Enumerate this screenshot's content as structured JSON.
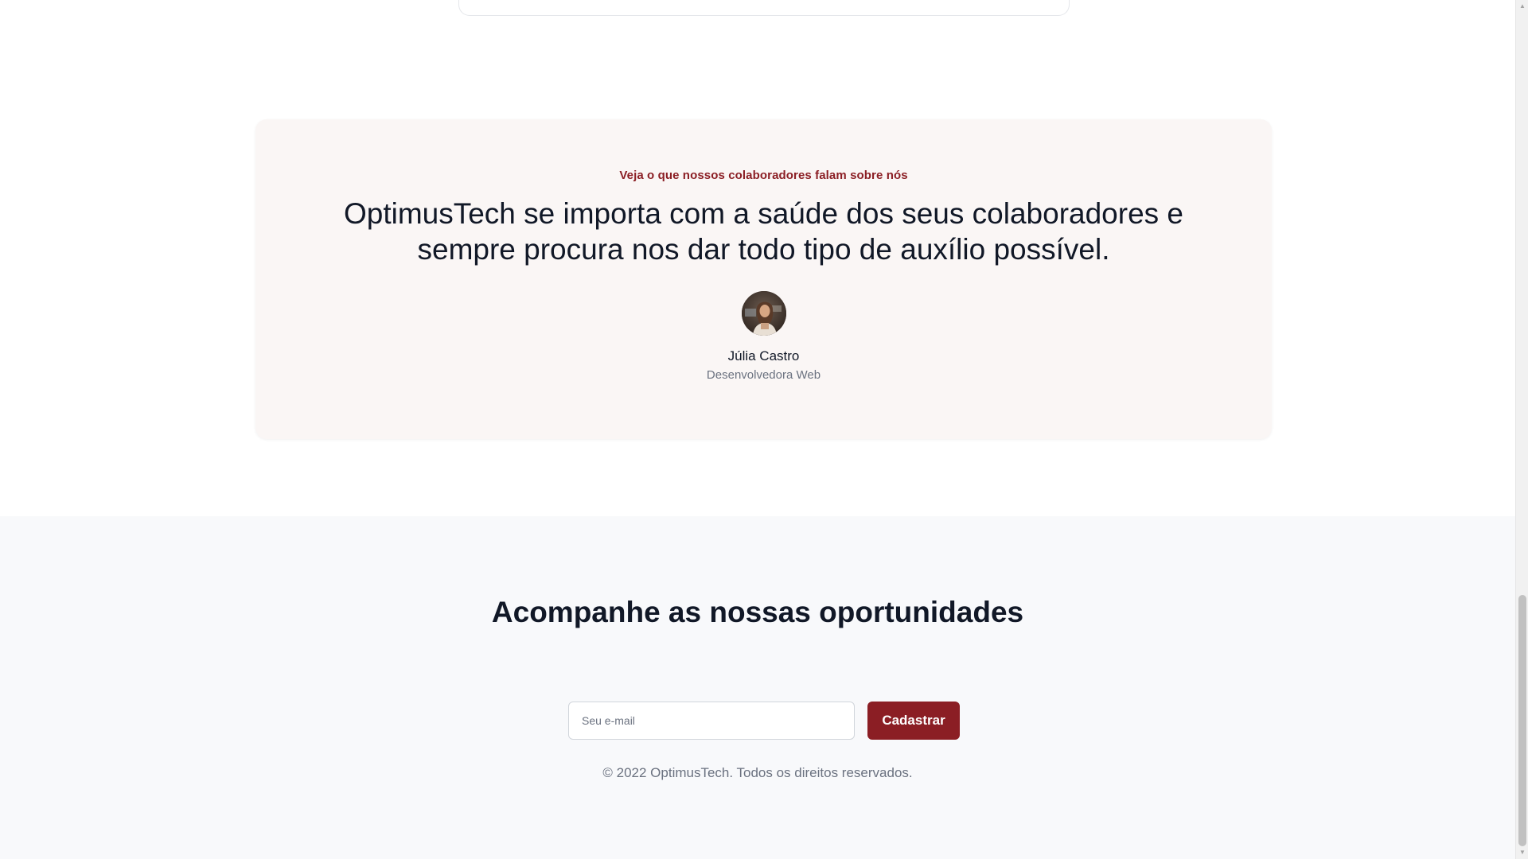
{
  "testimonial": {
    "eyebrow": "Veja o que nossos colaboradores falam sobre nós",
    "quote": "OptimusTech se importa com a saúde dos seus colaboradores e sempre procura nos dar todo tipo de auxílio possível.",
    "author_name": "Júlia Castro",
    "author_role": "Desenvolvedora Web",
    "avatar_icon": "person-photo"
  },
  "newsletter": {
    "heading": "Acompanhe as nossas oportunidades",
    "email_placeholder": "Seu e-mail",
    "email_value": "",
    "submit_label": "Cadastrar",
    "copyright": "© 2022 OptimusTech. Todos os direitos reservados."
  },
  "scrollbar": {
    "up_icon": "triangle-up",
    "down_icon": "triangle-down"
  },
  "colors": {
    "accent": "#8b1e24",
    "testimonial_bg": "#faf6f5",
    "footer_bg": "#f8f9fb",
    "text_primary": "#111827",
    "text_muted": "#6b7280"
  }
}
